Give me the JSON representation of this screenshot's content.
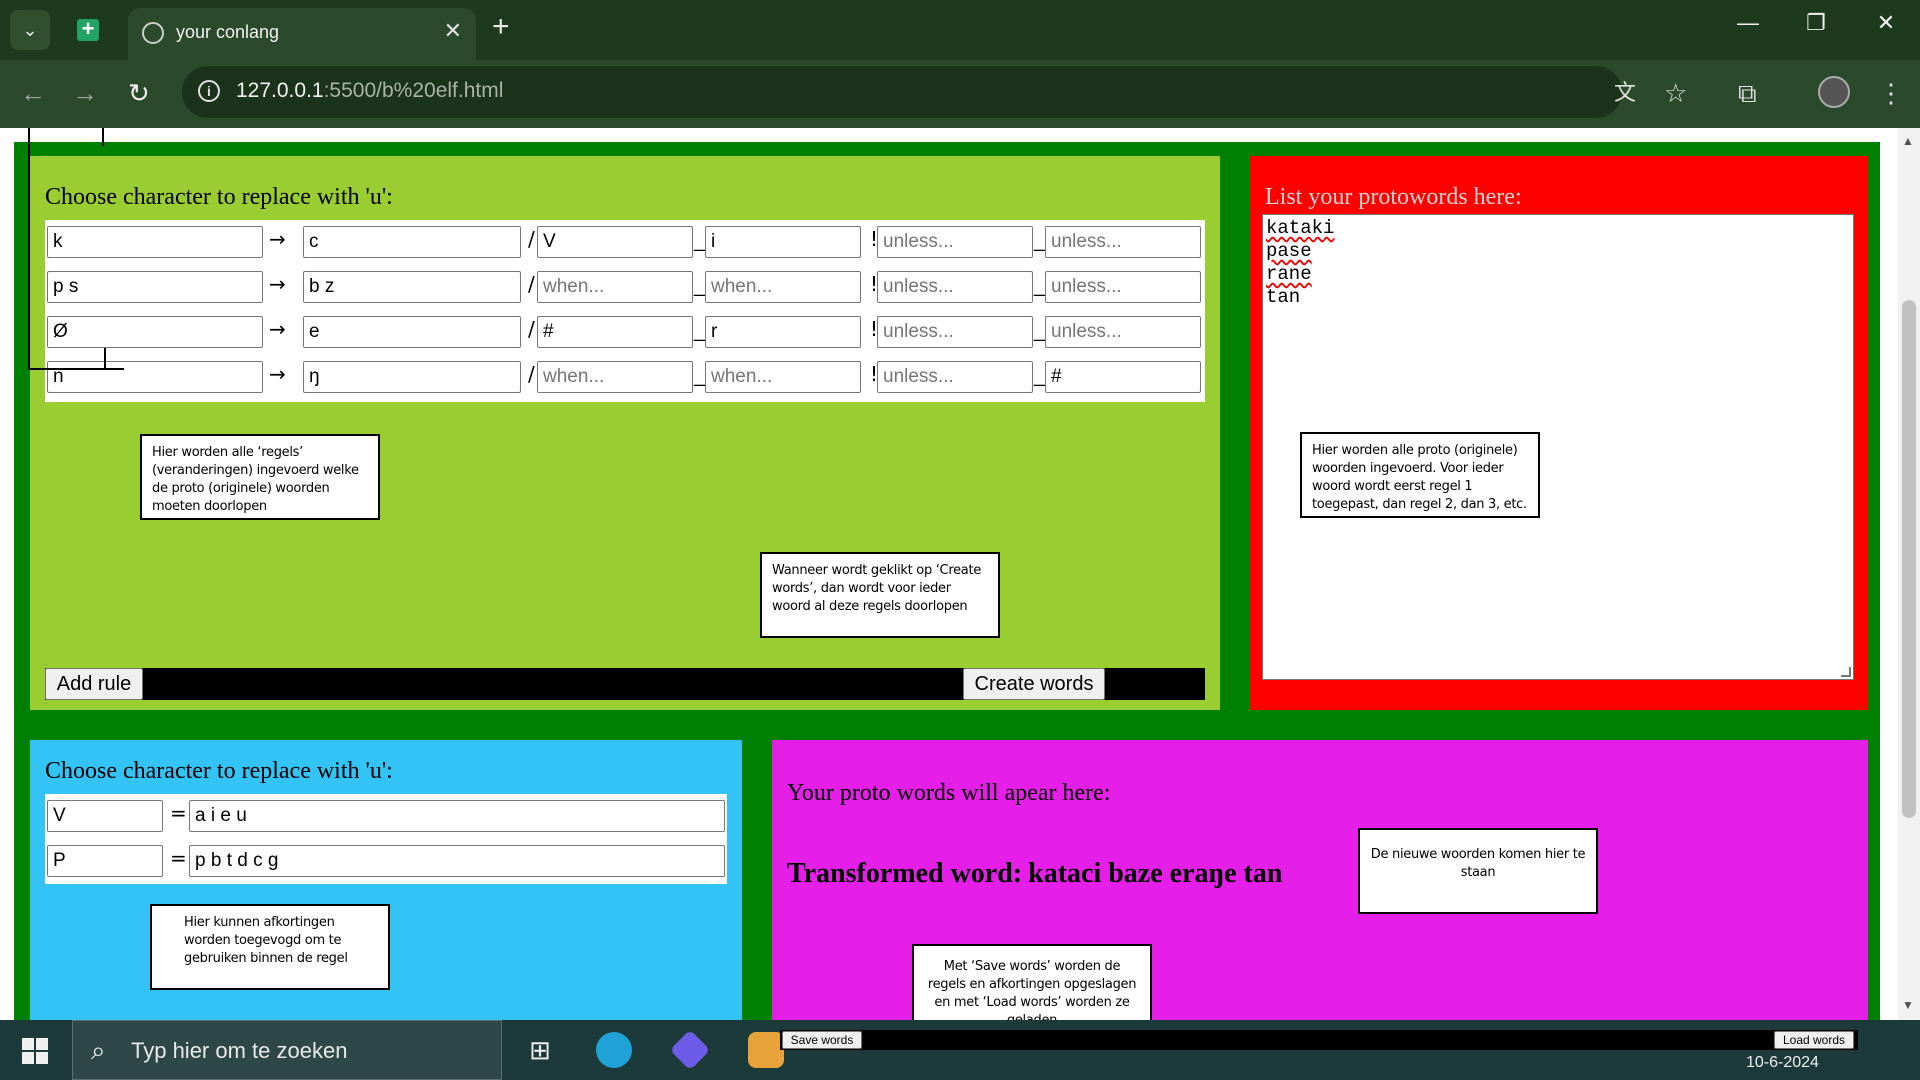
{
  "browser": {
    "tab_title": "your conlang",
    "url_host": "127.0.0.1",
    "url_rest": ":5500/b%20elf.html",
    "icons": [
      "tab-list-icon",
      "sheets-icon",
      "globe-icon",
      "close-icon",
      "plus-icon",
      "minimize-icon",
      "restore-icon",
      "window-close-icon",
      "back-icon",
      "forward-icon",
      "reload-icon",
      "info-icon",
      "translate-icon",
      "star-icon",
      "extensions-icon",
      "profile-avatar",
      "menu-icon"
    ]
  },
  "rules_panel": {
    "heading": "Choose character to replace with 'u':",
    "rows": [
      {
        "from": "k",
        "to": "c",
        "when1": "V",
        "when1_ph": false,
        "when2": "i",
        "when2_ph": false,
        "unless1": "unless...",
        "unless1_ph": true,
        "unless2": "unless...",
        "unless2_ph": true
      },
      {
        "from": "p s",
        "to": "b z",
        "when1": "when...",
        "when1_ph": true,
        "when2": "when...",
        "when2_ph": true,
        "unless1": "unless...",
        "unless1_ph": true,
        "unless2": "unless...",
        "unless2_ph": true
      },
      {
        "from": "Ø",
        "to": "e",
        "when1": "#",
        "when1_ph": false,
        "when2": "r",
        "when2_ph": false,
        "unless1": "unless...",
        "unless1_ph": true,
        "unless2": "unless...",
        "unless2_ph": true
      },
      {
        "from": "n",
        "to": "ŋ",
        "when1": "when...",
        "when1_ph": true,
        "when2": "when...",
        "when2_ph": true,
        "unless1": "unless...",
        "unless1_ph": true,
        "unless2": "#",
        "unless2_ph": false
      }
    ],
    "arrow": "→",
    "slash": "/",
    "underscore": "_",
    "bang": "!",
    "add_rule_label": "Add rule",
    "create_words_label": "Create words",
    "note_rules": "Hier worden alle ‘regels’ (veranderingen) ingevoerd welke de proto (originele) woorden moeten doorlopen",
    "note_create": "Wanneer wordt geklikt op ‘Create words’, dan wordt voor ieder woord al deze regels doorlopen"
  },
  "proto_panel": {
    "heading": "List your protowords here:",
    "words": [
      "kataki",
      "pase",
      "rane",
      "tan"
    ],
    "note": "Hier worden alle proto (originele) woorden ingevoerd. Voor ieder woord wordt eerst regel 1 toegepast, dan regel 2, dan 3, etc."
  },
  "abbr_panel": {
    "heading": "Choose character to replace with 'u':",
    "equals": "=",
    "rows": [
      {
        "key": "V",
        "value": "a i e u"
      },
      {
        "key": "P",
        "value": "p b t d c g"
      }
    ],
    "note": "Hier kunnen afkortingen worden toegevogd om te gebruiken binnen de regel"
  },
  "output_panel": {
    "heading": "Your proto words will apear here:",
    "transformed_label": "Transformed word:",
    "transformed_words": "kataci baze eraŋe tan",
    "note_output": "De nieuwe woorden komen hier te staan",
    "note_save": "Met ‘Save words’ worden de regels en afkortingen opgeslagen en met ‘Load words’ worden ze geladen",
    "save_label": "Save words",
    "load_label": "Load words"
  },
  "taskbar": {
    "search_placeholder": "Typ hier om te zoeken",
    "date": "10-6-2024"
  },
  "colors": {
    "outer": "#008000",
    "rules_bg": "#9acd32",
    "proto_bg": "#ff0000",
    "abbr_bg": "#33c3f5",
    "output_bg": "#e51ee8"
  }
}
